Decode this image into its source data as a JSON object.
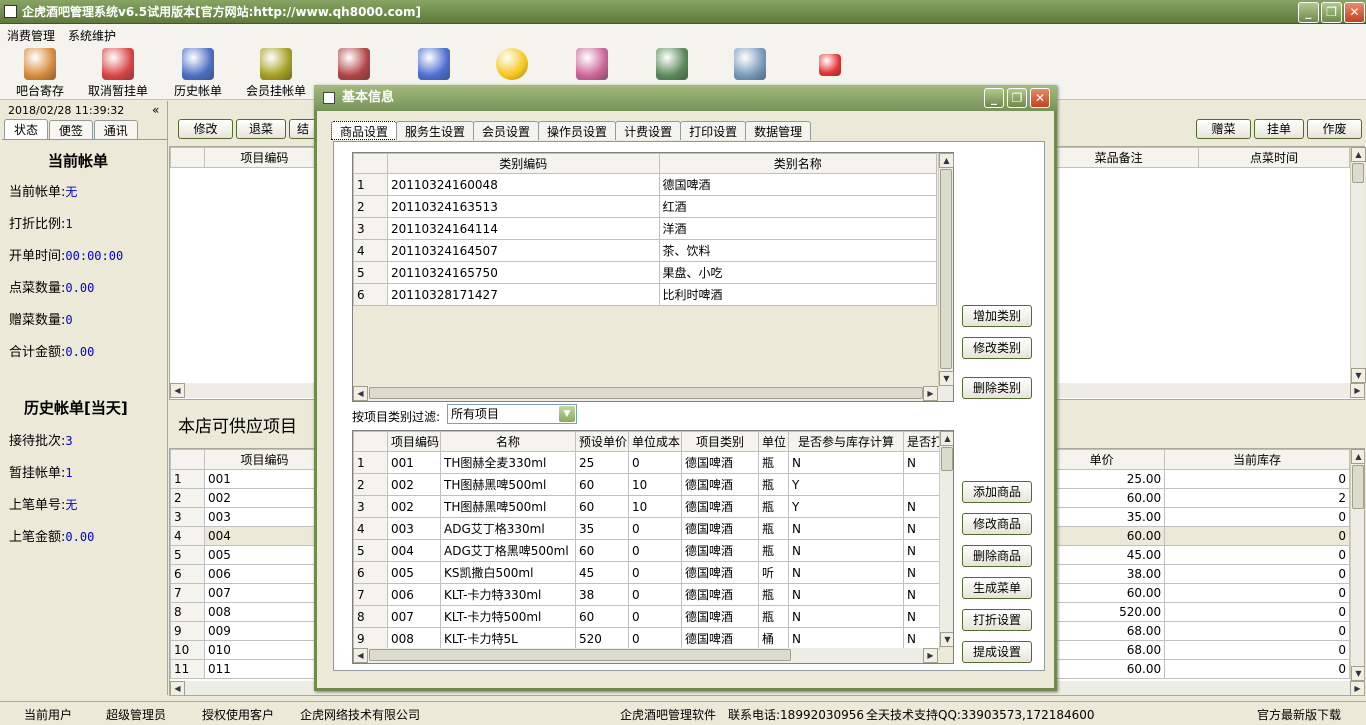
{
  "window": {
    "title": "企虎酒吧管理系统v6.5试用版本[官方网站:http://www.qh8000.com]",
    "min": "_",
    "restore": "❐",
    "close": "✕"
  },
  "menu": [
    "消费管理",
    "系统维护"
  ],
  "toolbar": [
    {
      "label": "吧台寄存",
      "icon": "storage-icon",
      "color": "#d88a3a"
    },
    {
      "label": "取消暂挂单",
      "icon": "cancel-hold-icon",
      "color": "#d94444"
    },
    {
      "label": "历史帐单",
      "icon": "clock-icon",
      "color": "#4c6fc4"
    },
    {
      "label": "会员挂帐单",
      "icon": "member-arrow-icon",
      "color": "#a5a020"
    },
    {
      "label": "",
      "icon": "calendar-pen-icon",
      "color": "#b24444"
    },
    {
      "label": "",
      "icon": "finder-face-icon",
      "color": "#4b6fd1"
    },
    {
      "label": "",
      "icon": "star-icon",
      "color": "#f5c518"
    },
    {
      "label": "",
      "icon": "calculator-icon",
      "color": "#cc6699"
    },
    {
      "label": "",
      "icon": "book-icon",
      "color": "#5a8a5a"
    },
    {
      "label": "",
      "icon": "handshake-icon",
      "color": "#7799bb"
    },
    {
      "label": "",
      "icon": "power-icon",
      "color": "#e53333"
    }
  ],
  "left": {
    "datetime": "2018/02/28 11:39:32",
    "tabs": [
      "状态",
      "便签",
      "通讯"
    ],
    "current_title": "当前帐单",
    "current": [
      {
        "label": "当前帐单:",
        "value": "无"
      },
      {
        "label": "打折比例:",
        "value": "1"
      },
      {
        "label": "开单时间:",
        "value": "00:00:00"
      },
      {
        "label": "点菜数量:",
        "value": "0.00"
      },
      {
        "label": "赠菜数量:",
        "value": "0"
      },
      {
        "label": "合计金额:",
        "value": "0.00"
      }
    ],
    "history_title": "历史帐单[当天]",
    "history": [
      {
        "label": "接待批次:",
        "value": "3"
      },
      {
        "label": "暂挂帐单:",
        "value": "1"
      },
      {
        "label": "上笔单号:",
        "value": "无"
      },
      {
        "label": "上笔金额:",
        "value": "0.00"
      }
    ]
  },
  "main": {
    "buttons_left": [
      "修改",
      "退菜",
      "结"
    ],
    "buttons_right": [
      "赠菜",
      "挂单",
      "作废"
    ],
    "order_headers": {
      "code": "项目编码",
      "note": "菜品备注",
      "time": "点菜时间"
    },
    "supply_title": "本店可供应项目",
    "supply_headers": {
      "code": "项目编码",
      "price": "单价",
      "stock": "当前库存"
    },
    "supply_rows": [
      {
        "n": "1",
        "code": "001",
        "price": "25.00",
        "stock": "0"
      },
      {
        "n": "2",
        "code": "002",
        "price": "60.00",
        "stock": "2"
      },
      {
        "n": "3",
        "code": "003",
        "price": "35.00",
        "stock": "0"
      },
      {
        "n": "4",
        "code": "004",
        "price": "60.00",
        "stock": "0"
      },
      {
        "n": "5",
        "code": "005",
        "price": "45.00",
        "stock": "0"
      },
      {
        "n": "6",
        "code": "006",
        "price": "38.00",
        "stock": "0"
      },
      {
        "n": "7",
        "code": "007",
        "price": "60.00",
        "stock": "0"
      },
      {
        "n": "8",
        "code": "008",
        "price": "520.00",
        "stock": "0"
      },
      {
        "n": "9",
        "code": "009",
        "price": "68.00",
        "stock": "0"
      },
      {
        "n": "10",
        "code": "010",
        "price": "68.00",
        "stock": "0"
      },
      {
        "n": "11",
        "code": "011",
        "price": "60.00",
        "stock": "0"
      }
    ]
  },
  "dialog": {
    "title": "基本信息",
    "tabs": [
      "商品设置",
      "服务生设置",
      "会员设置",
      "操作员设置",
      "计费设置",
      "打印设置",
      "数据管理"
    ],
    "cat_headers": [
      "类别编码",
      "类别名称"
    ],
    "cat_rows": [
      {
        "n": "1",
        "code": "20110324160048",
        "name": "德国啤酒"
      },
      {
        "n": "2",
        "code": "20110324163513",
        "name": "红酒"
      },
      {
        "n": "3",
        "code": "20110324164114",
        "name": "洋酒"
      },
      {
        "n": "4",
        "code": "20110324164507",
        "name": "茶、饮料"
      },
      {
        "n": "5",
        "code": "20110324165750",
        "name": "果盘、小吃"
      },
      {
        "n": "6",
        "code": "20110328171427",
        "name": "比利时啤酒"
      }
    ],
    "cat_buttons": [
      "增加类别",
      "修改类别",
      "删除类别"
    ],
    "filter_label": "按项目类别过滤:",
    "filter_value": "所有项目",
    "item_headers": [
      "项目编码",
      "名称",
      "预设单价",
      "单位成本",
      "项目类别",
      "单位",
      "是否参与库存计算",
      "是否打"
    ],
    "item_rows": [
      {
        "n": "1",
        "code": "001",
        "name": "TH图赫全麦330ml",
        "price": "25",
        "cost": "0",
        "cat": "德国啤酒",
        "unit": "瓶",
        "stock": "N",
        "p": "N"
      },
      {
        "n": "2",
        "code": "002",
        "name": "TH图赫黑啤500ml",
        "price": "60",
        "cost": "10",
        "cat": "德国啤酒",
        "unit": "瓶",
        "stock": "Y",
        "p": ""
      },
      {
        "n": "3",
        "code": "002",
        "name": "TH图赫黑啤500ml",
        "price": "60",
        "cost": "10",
        "cat": "德国啤酒",
        "unit": "瓶",
        "stock": "Y",
        "p": "N"
      },
      {
        "n": "4",
        "code": "003",
        "name": "ADG艾丁格330ml",
        "price": "35",
        "cost": "0",
        "cat": "德国啤酒",
        "unit": "瓶",
        "stock": "N",
        "p": "N"
      },
      {
        "n": "5",
        "code": "004",
        "name": "ADG艾丁格黑啤500ml",
        "price": "60",
        "cost": "0",
        "cat": "德国啤酒",
        "unit": "瓶",
        "stock": "N",
        "p": "N"
      },
      {
        "n": "6",
        "code": "005",
        "name": "KS凯撒白500ml",
        "price": "45",
        "cost": "0",
        "cat": "德国啤酒",
        "unit": "听",
        "stock": "N",
        "p": "N"
      },
      {
        "n": "7",
        "code": "006",
        "name": "KLT-卡力特330ml",
        "price": "38",
        "cost": "0",
        "cat": "德国啤酒",
        "unit": "瓶",
        "stock": "N",
        "p": "N"
      },
      {
        "n": "8",
        "code": "007",
        "name": "KLT-卡力特500ml",
        "price": "60",
        "cost": "0",
        "cat": "德国啤酒",
        "unit": "瓶",
        "stock": "N",
        "p": "N"
      },
      {
        "n": "9",
        "code": "008",
        "name": "KLT-卡力特5L",
        "price": "520",
        "cost": "0",
        "cat": "德国啤酒",
        "unit": "桶",
        "stock": "N",
        "p": "N"
      }
    ],
    "item_buttons": [
      "添加商品",
      "修改商品",
      "删除商品",
      "生成菜单",
      "打折设置",
      "提成设置"
    ]
  },
  "status": [
    "当前用户",
    "超级管理员",
    "授权使用客户",
    "企虎网络技术有限公司",
    "企虎酒吧管理软件",
    "联系电话:18992030956",
    "全天技术支持QQ:33903573,172184600",
    "官方最新版下载"
  ]
}
